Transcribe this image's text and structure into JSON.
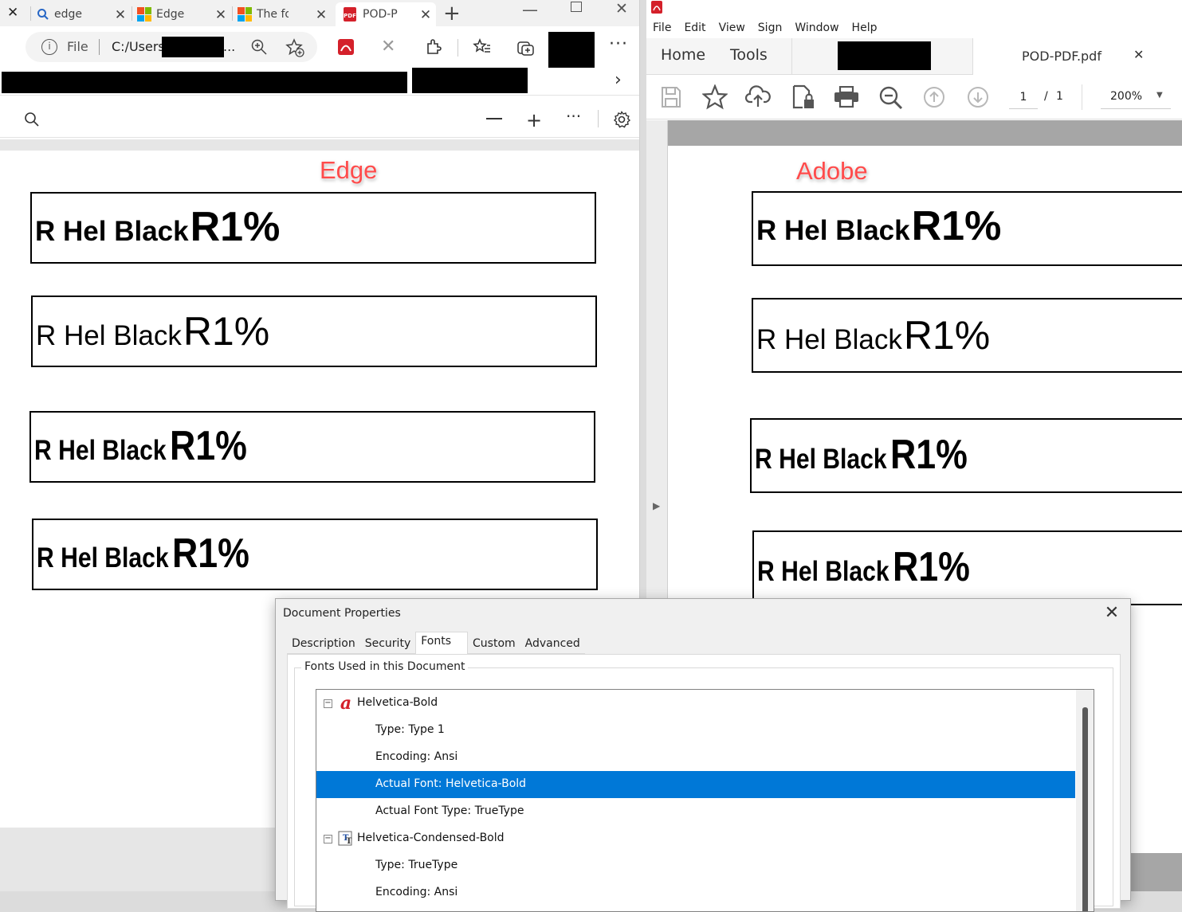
{
  "edge": {
    "tabs": [
      {
        "label": "edge PDF",
        "icon": "search-icon"
      },
      {
        "label": "Edge cannot",
        "icon": "microsoft-logo-icon"
      },
      {
        "label": "The font",
        "icon": "microsoft-logo-icon"
      },
      {
        "label": "POD-PDF",
        "icon": "pdf-icon"
      }
    ],
    "address": {
      "scheme": "File",
      "path": "C:/Users",
      "ellipsis": "..."
    },
    "annotation": "Edge",
    "samples": [
      {
        "regular": "R Hel Black",
        "large": "R1%"
      },
      {
        "regular": "R Hel Black",
        "large": "R1%"
      },
      {
        "regular": "R Hel Black",
        "large": "R1%"
      },
      {
        "regular": "R Hel Black",
        "large": "R1%"
      }
    ]
  },
  "adobe": {
    "menu": [
      "File",
      "Edit",
      "View",
      "Sign",
      "Window",
      "Help"
    ],
    "nav_tabs": {
      "home": "Home",
      "tools": "Tools"
    },
    "doc_tab": "POD-PDF.pdf",
    "page_current": "1",
    "page_sep": "/",
    "page_total": "1",
    "zoom": "200%",
    "annotation": "Adobe",
    "samples": [
      {
        "regular": "R Hel Black",
        "large": "R1%"
      },
      {
        "regular": "R Hel Black",
        "large": "R1%"
      },
      {
        "regular": "R Hel Black",
        "large": "R1%"
      },
      {
        "regular": "R Hel Black",
        "large": "R1%"
      }
    ]
  },
  "dialog": {
    "title": "Document Properties",
    "tabs": [
      "Description",
      "Security",
      "Fonts",
      "Custom",
      "Advanced"
    ],
    "active_tab": "Fonts",
    "group_label": "Fonts Used in this Document",
    "fonts": [
      {
        "name": "Helvetica-Bold",
        "icon": "type1-font-icon",
        "details": [
          "Type: Type 1",
          "Encoding: Ansi",
          "Actual Font: Helvetica-Bold",
          "Actual Font Type: TrueType"
        ]
      },
      {
        "name": "Helvetica-Condensed-Bold",
        "icon": "truetype-font-icon",
        "details": [
          "Type: TrueType",
          "Encoding: Ansi"
        ]
      }
    ],
    "selected_item": "Actual Font: Helvetica-Bold",
    "selection_color": "#0078d7"
  },
  "colors": {
    "annotation": "#ff4b4b",
    "pdf_red": "#d4202a"
  }
}
